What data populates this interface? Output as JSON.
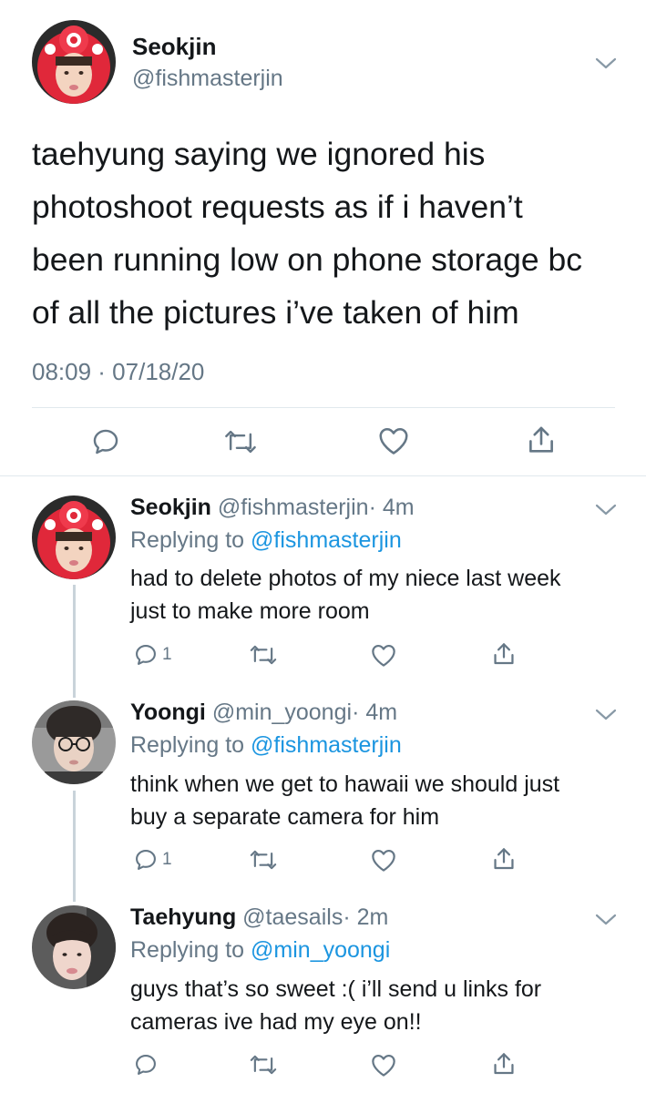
{
  "main_tweet": {
    "author_name": "Seokjin",
    "author_handle": "@fishmasterjin",
    "text_lines": [
      "taehyung saying we ignored his",
      "photoshoot requests as if i haven’t",
      "been running low on phone storage bc",
      "of all the pictures i’ve taken of him"
    ],
    "timestamp": "08:09 · 07/18/20",
    "actions": [
      "reply-icon",
      "retweet-icon",
      "like-icon",
      "share-icon"
    ]
  },
  "replies": [
    {
      "author_name": "Seokjin",
      "author_handle": "@fishmasterjin",
      "time": "· 4m",
      "replying_prefix": "Replying to ",
      "replying_to": "@fishmasterjin",
      "text_lines": [
        "had to delete photos of my niece last week",
        "just to make more room"
      ],
      "reply_count": "1"
    },
    {
      "author_name": "Yoongi",
      "author_handle": "@min_yoongi",
      "time": "· 4m",
      "replying_prefix": "Replying to ",
      "replying_to": "@fishmasterjin",
      "text_lines": [
        "think when we get to hawaii we should just",
        "buy a separate camera for him"
      ],
      "reply_count": "1"
    },
    {
      "author_name": "Taehyung",
      "author_handle": "@taesails",
      "time": "· 2m",
      "replying_prefix": "Replying to ",
      "replying_to": "@min_yoongi",
      "text_lines": [
        "guys that’s so sweet :( i’ll send u links for",
        "cameras ive had my eye on!!"
      ],
      "reply_count": ""
    }
  ],
  "colors": {
    "text": "#14171a",
    "secondary": "#657786",
    "link": "#1b95e0",
    "divider": "#e1e8ed"
  }
}
